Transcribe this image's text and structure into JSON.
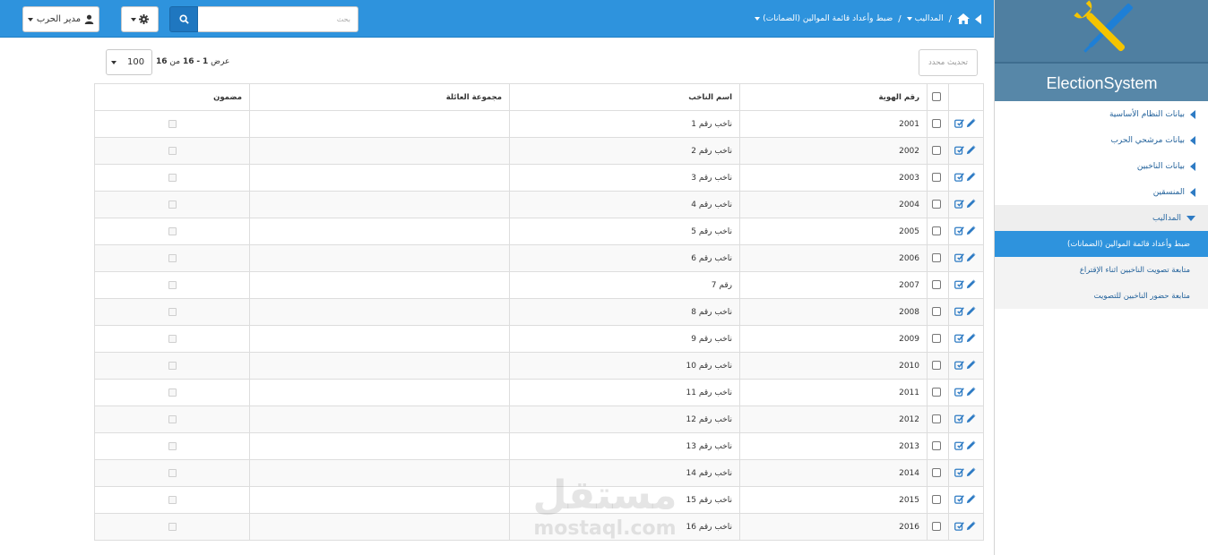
{
  "topbar": {
    "user_menu_label": "مدير الحرب",
    "search_placeholder": "بحث",
    "breadcrumb": {
      "level1": "المداليب",
      "level2": "ضبط وأعداد قائمة الموالين (الضمانات)"
    }
  },
  "sidebar": {
    "brand": "ElectionSystem",
    "items": [
      {
        "label": "بيانات النظام الأساسية"
      },
      {
        "label": "بيانات مرشحي الحرب"
      },
      {
        "label": "بيانات الناخبين"
      },
      {
        "label": "المنسقين"
      },
      {
        "label": "المداليب"
      }
    ],
    "sub_items": [
      {
        "label": "ضبط وأعداد قائمة الموالين (الضمانات)"
      },
      {
        "label": "متابعة تصويت الناخبين اثناء الإقتراع"
      },
      {
        "label": "متابعة حضور الناخبين للتصويت"
      }
    ]
  },
  "toolbar": {
    "refresh_label": "تحديث محدد",
    "pager_prefix": "عرض",
    "pager_from": "1",
    "pager_dash": "-",
    "pager_to": "16",
    "pager_of": "من",
    "pager_total": "16",
    "page_size": "100"
  },
  "table": {
    "headers": {
      "id": "رقم الهوية",
      "name": "اسم الناخب",
      "family": "مجموعة العائلة",
      "guaranteed": "مضمون"
    },
    "rows": [
      {
        "id": "2001",
        "name": "ناخب رقم 1",
        "family": ""
      },
      {
        "id": "2002",
        "name": "ناخب رقم 2",
        "family": ""
      },
      {
        "id": "2003",
        "name": "ناخب رقم 3",
        "family": ""
      },
      {
        "id": "2004",
        "name": "ناخب رقم 4",
        "family": ""
      },
      {
        "id": "2005",
        "name": "ناخب رقم 5",
        "family": ""
      },
      {
        "id": "2006",
        "name": "ناخب رقم 6",
        "family": ""
      },
      {
        "id": "2007",
        "name": "رقم 7",
        "family": ""
      },
      {
        "id": "2008",
        "name": "ناخب رقم 8",
        "family": ""
      },
      {
        "id": "2009",
        "name": "ناخب رقم 9",
        "family": ""
      },
      {
        "id": "2010",
        "name": "ناخب رقم 10",
        "family": ""
      },
      {
        "id": "2011",
        "name": "ناخب رقم 11",
        "family": ""
      },
      {
        "id": "2012",
        "name": "ناخب رقم 12",
        "family": ""
      },
      {
        "id": "2013",
        "name": "ناخب رقم 13",
        "family": ""
      },
      {
        "id": "2014",
        "name": "ناخب رقم 14",
        "family": ""
      },
      {
        "id": "2015",
        "name": "ناخب رقم 15",
        "family": ""
      },
      {
        "id": "2016",
        "name": "ناخب رقم 16",
        "family": ""
      }
    ]
  },
  "watermark": {
    "arabic": "مستقل",
    "latin": "mostaql.com"
  },
  "colors": {
    "topbar": "#2e93dd",
    "sidebar_header": "#5787a8",
    "active_menu": "#2e93dd",
    "logo_wrench": "#f5c400",
    "logo_screwdriver": "#1e7fd6"
  }
}
